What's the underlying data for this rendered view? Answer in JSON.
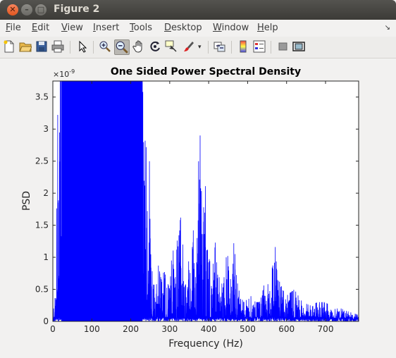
{
  "window": {
    "title": "Figure 2"
  },
  "menu": [
    {
      "label": "File",
      "mn": "F",
      "rest": "ile"
    },
    {
      "label": "Edit",
      "mn": "E",
      "rest": "dit"
    },
    {
      "label": "View",
      "mn": "V",
      "rest": "iew"
    },
    {
      "label": "Insert",
      "mn": "I",
      "rest": "nsert"
    },
    {
      "label": "Tools",
      "mn": "T",
      "rest": "ools"
    },
    {
      "label": "Desktop",
      "mn": "D",
      "rest": "esktop"
    },
    {
      "label": "Window",
      "mn": "W",
      "rest": "indow"
    },
    {
      "label": "Help",
      "mn": "H",
      "rest": "elp"
    }
  ],
  "toolbar": {
    "icons": [
      "new-figure-icon",
      "open-file-icon",
      "save-icon",
      "print-icon",
      "edit-plot-arrow-icon",
      "zoom-in-icon",
      "zoom-out-icon",
      "pan-hand-icon",
      "rotate-3d-icon",
      "data-cursor-icon",
      "brush-icon",
      "link-plot-icon",
      "colorbar-icon",
      "legend-icon",
      "hide-plot-tools-icon",
      "show-plot-tools-icon"
    ],
    "active": "zoom-out-icon"
  },
  "chart_data": {
    "type": "line",
    "title": "One Sided Power Spectral Density",
    "xlabel": "Frequency (Hz)",
    "ylabel": "PSD",
    "y_exponent_label": "×10",
    "y_exponent": "-9",
    "xlim": [
      0,
      785
    ],
    "ylim": [
      0,
      3.75
    ],
    "xticks": [
      "0",
      "100",
      "200",
      "300",
      "400",
      "500",
      "600",
      "700"
    ],
    "yticks": [
      "0",
      "0.5",
      "1",
      "1.5",
      "2",
      "2.5",
      "3",
      "3.5"
    ],
    "line_color": "#0000ff",
    "series": [
      {
        "x": [
          0,
          8,
          12,
          15,
          20,
          40,
          60,
          80,
          100,
          120,
          140,
          160,
          180,
          200,
          220,
          230,
          235,
          240,
          245,
          248,
          250,
          255,
          258,
          265,
          270,
          280,
          285,
          290,
          300,
          305,
          310,
          315,
          320,
          325,
          330,
          335,
          340,
          345,
          350,
          355,
          360,
          365,
          370,
          375,
          378,
          380,
          382,
          385,
          390,
          395,
          400,
          405,
          410,
          415,
          420,
          425,
          430,
          435,
          440,
          445,
          450,
          455,
          460,
          465,
          470,
          475,
          480,
          490,
          500,
          510,
          520,
          530,
          540,
          545,
          550,
          555,
          560,
          565,
          570,
          575,
          580,
          585,
          590,
          600,
          620,
          640,
          660,
          680,
          700,
          720,
          740,
          760,
          785
        ],
        "y": [
          0.1,
          0.5,
          3.4,
          3.75,
          3.75,
          3.75,
          3.75,
          3.75,
          3.75,
          3.75,
          3.75,
          3.75,
          3.75,
          3.75,
          3.75,
          3.75,
          2.9,
          2.7,
          1.2,
          2.5,
          1.3,
          0.9,
          0.6,
          0.5,
          0.9,
          0.6,
          0.8,
          0.7,
          0.5,
          1.0,
          1.3,
          0.7,
          1.4,
          1.5,
          1.7,
          1.1,
          0.5,
          1.2,
          1.1,
          0.5,
          1.6,
          0.6,
          1.5,
          3.15,
          2.9,
          1.8,
          3.1,
          1.3,
          2.5,
          1.2,
          1.0,
          0.9,
          0.6,
          1.6,
          0.9,
          1.1,
          1.0,
          1.2,
          0.7,
          1.0,
          1.1,
          0.7,
          0.5,
          1.3,
          0.8,
          0.6,
          0.4,
          0.3,
          0.35,
          0.4,
          0.3,
          0.3,
          0.5,
          0.7,
          0.7,
          0.4,
          0.6,
          1.0,
          1.25,
          0.8,
          0.6,
          0.7,
          0.5,
          0.4,
          0.5,
          0.3,
          0.25,
          0.3,
          0.3,
          0.2,
          0.2,
          0.15,
          0.1
        ]
      }
    ]
  }
}
